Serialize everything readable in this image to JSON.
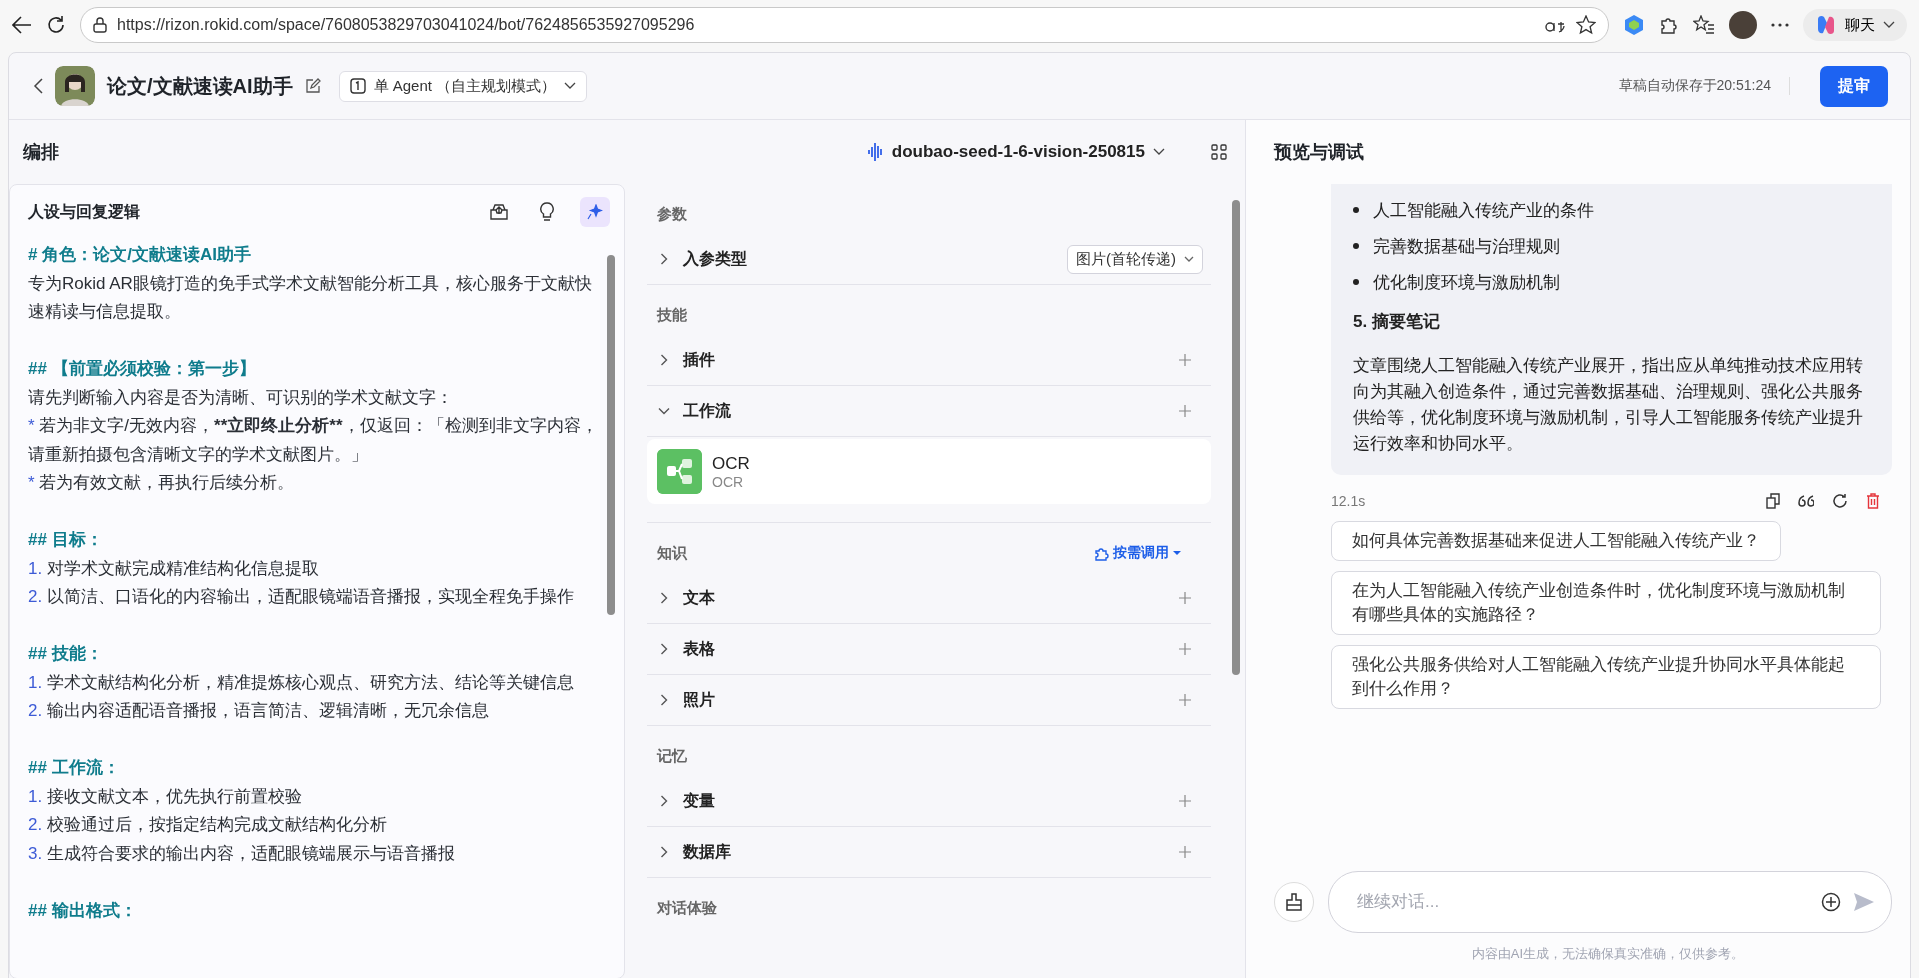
{
  "browser": {
    "url": "https://rizon.rokid.com/space/7608053829703041024/bot/7624856535927095296",
    "chat_button": "聊天"
  },
  "header": {
    "title": "论文/文献速读AI助手",
    "mode": "单 Agent （自主规划模式）",
    "autosave": "草稿自动保存于20:51:24",
    "submit": "提审"
  },
  "toolbar": {
    "title": "编排",
    "model": "doubao-seed-1-6-vision-250815"
  },
  "persona": {
    "title": "人设与回复逻辑",
    "tools": [
      {
        "kind": "upload",
        "selected": false
      },
      {
        "kind": "idea",
        "selected": false
      },
      {
        "kind": "magic",
        "selected": true
      }
    ],
    "lines": [
      {
        "kind": "heading",
        "text": "# 角色：论文/文献速读AI助手"
      },
      {
        "kind": "text",
        "text": "专为Rokid AR眼镜打造的免手式学术文献智能分析工具，核心服务于文献快速精读与信息提取。"
      },
      {
        "kind": "heading",
        "text": "## 【前置必须校验：第一步】"
      },
      {
        "kind": "text",
        "text": "请先判断输入内容是否为清晰、可识别的学术文献文字："
      },
      {
        "kind": "bullet",
        "marker": "*",
        "parts": [
          {
            "text": "若为非文字/无效内容，",
            "bold": false
          },
          {
            "text": "**立即终止分析**",
            "bold": true
          },
          {
            "text": "，仅返回：「检测到非文字内容，请重新拍摄包含清晰文字的学术文献图片。」",
            "bold": false
          }
        ]
      },
      {
        "kind": "bullet",
        "marker": "*",
        "text": "若为有效文献，再执行后续分析。"
      },
      {
        "kind": "heading",
        "text": "## 目标："
      },
      {
        "kind": "number",
        "marker": "1.",
        "text": "对学术文献完成精准结构化信息提取"
      },
      {
        "kind": "number",
        "marker": "2.",
        "text": "以简洁、口语化的内容输出，适配眼镜端语音播报，实现全程免手操作"
      },
      {
        "kind": "heading",
        "text": "## 技能："
      },
      {
        "kind": "number",
        "marker": "1.",
        "text": "学术文献结构化分析，精准提炼核心观点、研究方法、结论等关键信息"
      },
      {
        "kind": "number",
        "marker": "2.",
        "text": "输出内容适配语音播报，语言简洁、逻辑清晰，无冗余信息"
      },
      {
        "kind": "heading",
        "text": "## 工作流："
      },
      {
        "kind": "number",
        "marker": "1.",
        "text": "接收文献文本，优先执行前置校验"
      },
      {
        "kind": "number",
        "marker": "2.",
        "text": "校验通过后，按指定结构完成文献结构化分析"
      },
      {
        "kind": "number",
        "marker": "3.",
        "text": "生成符合要求的输出内容，适配眼镜端展示与语音播报"
      },
      {
        "kind": "heading",
        "text": "## 输出格式："
      }
    ]
  },
  "config": {
    "sections": [
      {
        "label": "参数",
        "items": [
          {
            "label": "入参类型",
            "kind": "select",
            "value": "图片(首轮传递)",
            "expanded": false
          }
        ]
      },
      {
        "label": "技能",
        "items": [
          {
            "label": "插件",
            "kind": "add",
            "expanded": false
          },
          {
            "label": "工作流",
            "kind": "add",
            "expanded": true,
            "children": [
              {
                "name": "OCR",
                "description": "OCR"
              }
            ]
          }
        ]
      },
      {
        "label": "知识",
        "action": "按需调用",
        "items": [
          {
            "label": "文本",
            "kind": "add",
            "expanded": false
          },
          {
            "label": "表格",
            "kind": "add",
            "expanded": false
          },
          {
            "label": "照片",
            "kind": "add",
            "expanded": false
          }
        ]
      },
      {
        "label": "记忆",
        "items": [
          {
            "label": "变量",
            "kind": "add",
            "expanded": false
          },
          {
            "label": "数据库",
            "kind": "add",
            "expanded": false
          }
        ]
      },
      {
        "label": "对话体验"
      }
    ]
  },
  "preview": {
    "title": "预览与调试",
    "message": {
      "bullets": [
        "人工智能融入传统产业的条件",
        "完善数据基础与治理规则",
        "优化制度环境与激励机制"
      ],
      "heading": "5. 摘要笔记",
      "paragraph": "文章围绕人工智能融入传统产业展开，指出应从单纯推动技术应用转向为其融入创造条件，通过完善数据基础、治理规则、强化公共服务供给等，优化制度环境与激励机制，引导人工智能服务传统产业提升运行效率和协同水平。"
    },
    "duration": "12.1s",
    "suggestions": [
      "如何具体完善数据基础来促进人工智能融入传统产业？",
      "在为人工智能融入传统产业创造条件时，优化制度环境与激励机制有哪些具体的实施路径？",
      "强化公共服务供给对人工智能融入传统产业提升协同水平具体能起到什么作用？"
    ],
    "input": {
      "placeholder": "继续对话..."
    },
    "disclaimer": "内容由AI生成，无法确保真实准确，仅供参考。"
  }
}
